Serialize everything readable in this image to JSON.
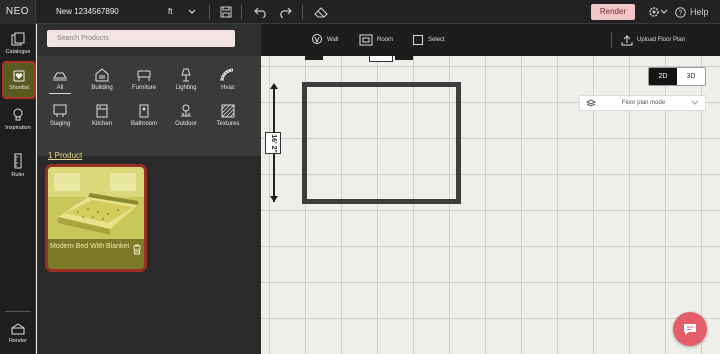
{
  "app": {
    "logo": "NEO",
    "project_name": "New 1234567890"
  },
  "topbar": {
    "unit": "ft",
    "render_label": "Render",
    "help_label": "Help",
    "colors": {
      "render_bg": "#f2c6c6",
      "bar_bg": "#222222"
    }
  },
  "rail": {
    "items": [
      {
        "label": "Catalogue",
        "icon": "catalogue-icon"
      },
      {
        "label": "Shortlist",
        "icon": "shortlist-heart-icon",
        "active": true
      },
      {
        "label": "Inspiration",
        "icon": "bulb-icon"
      },
      {
        "label": "Ruler",
        "icon": "ruler-icon"
      },
      {
        "label": "Render",
        "icon": "render-icon"
      }
    ]
  },
  "panel": {
    "search_placeholder": "Search Products",
    "categories": [
      {
        "label": "All",
        "icon": "all-icon",
        "selected": true
      },
      {
        "label": "Building",
        "icon": "building-icon"
      },
      {
        "label": "Furniture",
        "icon": "furniture-icon"
      },
      {
        "label": "Lighting",
        "icon": "lighting-icon"
      },
      {
        "label": "Hvac",
        "icon": "hvac-icon"
      },
      {
        "label": "Staging",
        "icon": "staging-icon"
      },
      {
        "label": "Kitchen",
        "icon": "kitchen-icon"
      },
      {
        "label": "Bathroom",
        "icon": "bathroom-icon"
      },
      {
        "label": "Outdoor",
        "icon": "outdoor-icon"
      },
      {
        "label": "Textures",
        "icon": "textures-icon"
      }
    ],
    "product_count": "1 Product",
    "products": [
      {
        "title": "Modern Bed With Blanket"
      }
    ]
  },
  "toolbar": {
    "wall": "Wall",
    "room": "Room",
    "select": "Select",
    "upload": "Upload Floor Plan"
  },
  "canvas": {
    "view_2d": "2D",
    "view_3d": "3D",
    "active_view": "2D",
    "mode": "Floor plan mode",
    "dimension": "16' 2\""
  }
}
